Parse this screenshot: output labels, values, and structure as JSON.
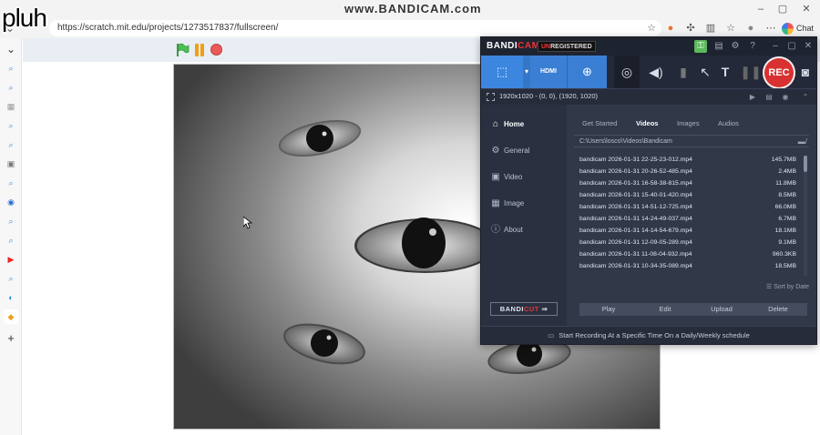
{
  "browser": {
    "url": "https://scratch.mit.edu/projects/1273517837/fullscreen/",
    "chat_label": "Chat",
    "overlay_text": "pluh",
    "watermark": "www.BANDICAM.com"
  },
  "scratch": {
    "flag_icon": "green-flag-icon",
    "pause_icon": "pause-icon",
    "stop_icon": "stop-icon",
    "flag_color": "#4cbf56",
    "pause_color": "#f0a015",
    "stop_color": "#ec5959"
  },
  "bandicam": {
    "logo_left": "BANDI",
    "logo_right": "CAM",
    "unregistered_left": "UN",
    "unregistered_right": "REGISTERED",
    "mode_hdmi_label": "HDMI",
    "rec_label": "REC",
    "text_tool_label": "T",
    "resolution": "1920x1020 - (0, 0), (1920, 1020)",
    "nav": [
      {
        "label": "Home",
        "icon": "home-icon",
        "glyph": "⌂"
      },
      {
        "label": "General",
        "icon": "gear-icon",
        "glyph": "⚙"
      },
      {
        "label": "Video",
        "icon": "video-icon",
        "glyph": "▣"
      },
      {
        "label": "Image",
        "icon": "image-icon",
        "glyph": "▦"
      },
      {
        "label": "About",
        "icon": "info-icon",
        "glyph": "ⓘ"
      }
    ],
    "bandicut_left": "BANDI",
    "bandicut_right": "CUT",
    "tabs": [
      "Get Started",
      "Videos",
      "Images",
      "Audios"
    ],
    "folder_path": "C:\\Users\\losco\\Videos\\Bandicam",
    "files": [
      {
        "name": "bandicam 2026-01-31 22-25-23-012.mp4",
        "size": "145.7MB"
      },
      {
        "name": "bandicam 2026-01-31 20-26-52-485.mp4",
        "size": "2.4MB"
      },
      {
        "name": "bandicam 2026-01-31 16-58-38-815.mp4",
        "size": "11.8MB"
      },
      {
        "name": "bandicam 2026-01-31 15-40-01-420.mp4",
        "size": "8.5MB"
      },
      {
        "name": "bandicam 2026-01-31 14-51-12-725.mp4",
        "size": "66.0MB"
      },
      {
        "name": "bandicam 2026-01-31 14-24-49-037.mp4",
        "size": "6.7MB"
      },
      {
        "name": "bandicam 2026-01-31 14-14-54-679.mp4",
        "size": "18.1MB"
      },
      {
        "name": "bandicam 2026-01-31 12-09-05-289.mp4",
        "size": "9.1MB"
      },
      {
        "name": "bandicam 2026-01-31 11-08-04-932.mp4",
        "size": "960.3KB"
      },
      {
        "name": "bandicam 2026-01-31 10-34-35-089.mp4",
        "size": "18.5MB"
      }
    ],
    "sort_label": "Sort by Date",
    "buttons": [
      "Play",
      "Edit",
      "Upload",
      "Delete"
    ],
    "footer": "Start Recording At a Specific Time On a Daily/Weekly schedule",
    "rec_color": "#d93131",
    "accent_color": "#3a7fd4"
  }
}
